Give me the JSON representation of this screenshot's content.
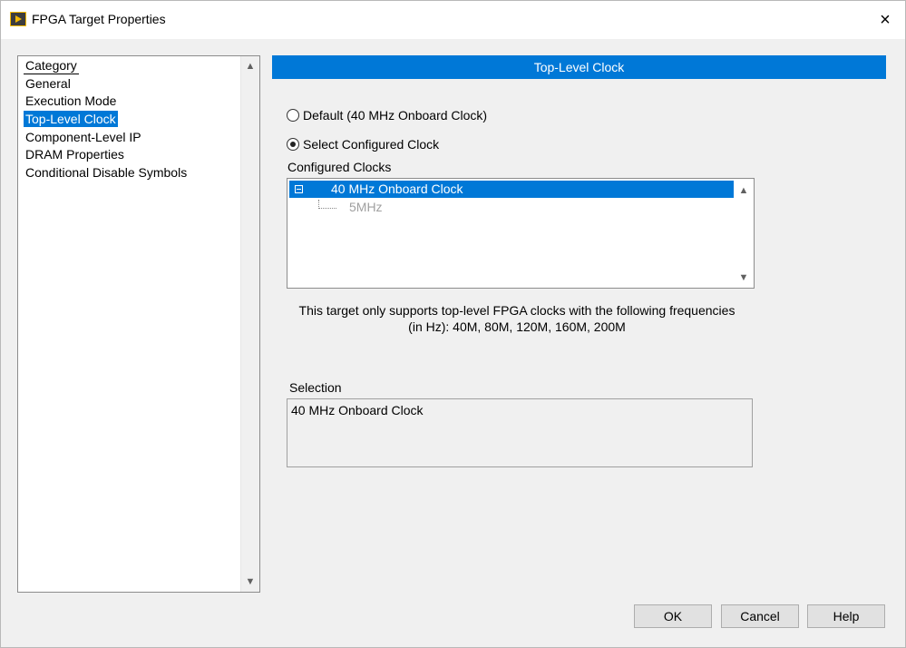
{
  "window": {
    "title": "FPGA Target Properties",
    "close_glyph": "×"
  },
  "category": {
    "header": "Category",
    "items": [
      {
        "label": "General",
        "selected": false
      },
      {
        "label": "Execution Mode",
        "selected": false
      },
      {
        "label": "Top-Level Clock",
        "selected": true
      },
      {
        "label": "Component-Level IP",
        "selected": false
      },
      {
        "label": "DRAM Properties",
        "selected": false
      },
      {
        "label": "Conditional Disable Symbols",
        "selected": false
      }
    ],
    "scroll_up": "⌃",
    "scroll_down": "⌄"
  },
  "panel": {
    "title": "Top-Level Clock",
    "radio_default": {
      "label": "Default (40 MHz Onboard Clock)",
      "checked": false
    },
    "radio_select": {
      "label": "Select Configured Clock",
      "checked": true
    },
    "configured_clocks_label": "Configured Clocks",
    "clocks_tree": {
      "root": "40 MHz Onboard Clock",
      "child": "5MHz"
    },
    "info_line1": "This target only supports top-level FPGA clocks with the following frequencies",
    "info_line2": "(in Hz): 40M, 80M, 120M, 160M, 200M",
    "selection_label": "Selection",
    "selection_value": "40 MHz Onboard Clock"
  },
  "buttons": {
    "ok": "OK",
    "cancel": "Cancel",
    "help": "Help"
  },
  "colors": {
    "accent": "#0078d7"
  }
}
